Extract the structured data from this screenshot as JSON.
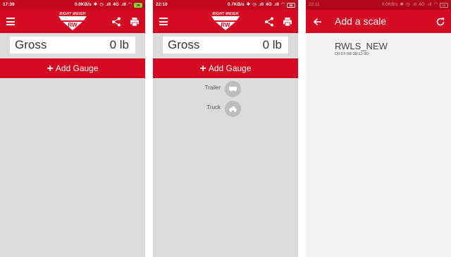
{
  "colors": {
    "brand_red": "#d40a22",
    "status_red": "#c2081c",
    "panel_gray": "#dcdcdc"
  },
  "logo_text": "RIGHT WEIGH",
  "screens": [
    {
      "status": {
        "time": "17:39",
        "speed": "0.0KB/s",
        "network": "4G",
        "battery": "39"
      },
      "gross": {
        "label": "Gross",
        "value": "0 lb"
      },
      "add_gauge": "Add Gauge"
    },
    {
      "status": {
        "time": "22:10",
        "speed": "0.7KB/s",
        "network": "4G",
        "battery": "56"
      },
      "gross": {
        "label": "Gross",
        "value": "0 lb"
      },
      "add_gauge": "Add Gauge",
      "gauge_options": [
        {
          "label": "Trailer",
          "icon": "trailer-icon"
        },
        {
          "label": "Truck",
          "icon": "truck-icon"
        }
      ]
    },
    {
      "status": {
        "time": "22:11",
        "speed": "0.0KB/s",
        "network": "4G",
        "battery": "56"
      },
      "title": "Add a scale",
      "scale": {
        "name": "RWLS_NEW",
        "mac": "D0:CF:5E:38:12:9D"
      }
    }
  ]
}
